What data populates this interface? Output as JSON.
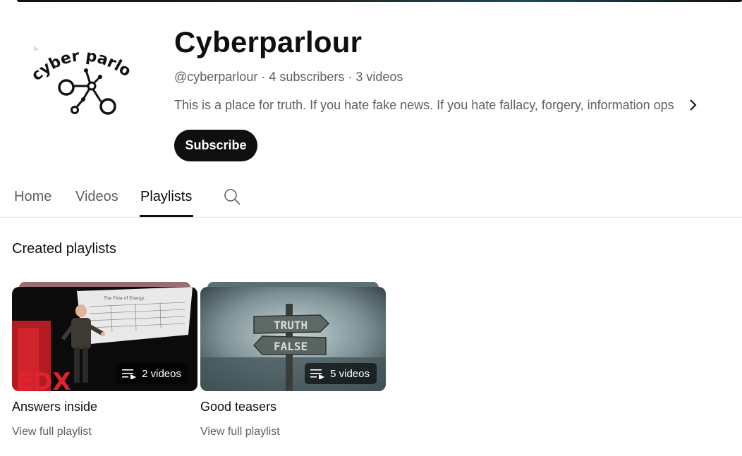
{
  "channel": {
    "logo_text": "cyber parlour",
    "name": "Cyberparlour",
    "meta": "@cyberparlour · 4 subscribers · 3 videos",
    "description": "This is a place for truth. If you hate fake news. If you hate fallacy, forgery, information ops ...",
    "subscribe_label": "Subscribe"
  },
  "tabs": [
    {
      "label": "Home",
      "active": false
    },
    {
      "label": "Videos",
      "active": false
    },
    {
      "label": "Playlists",
      "active": true
    }
  ],
  "section_title": "Created playlists",
  "playlists": [
    {
      "title": "Answers inside",
      "count": "2 videos",
      "link": "View full playlist",
      "thumb_text": "The Flow of Energy"
    },
    {
      "title": "Good teasers",
      "count": "5 videos",
      "link": "View full playlist",
      "sign_top": "TRUTH",
      "sign_bottom": "FALSE"
    }
  ],
  "icons": {
    "description_more": "chevron-right-icon",
    "tab_search": "search-icon",
    "playlist_count": "playlist-icon"
  },
  "colors": {
    "text_primary": "#0f0f0f",
    "text_secondary": "#606060",
    "subscribe_bg": "#0f0f0f"
  }
}
